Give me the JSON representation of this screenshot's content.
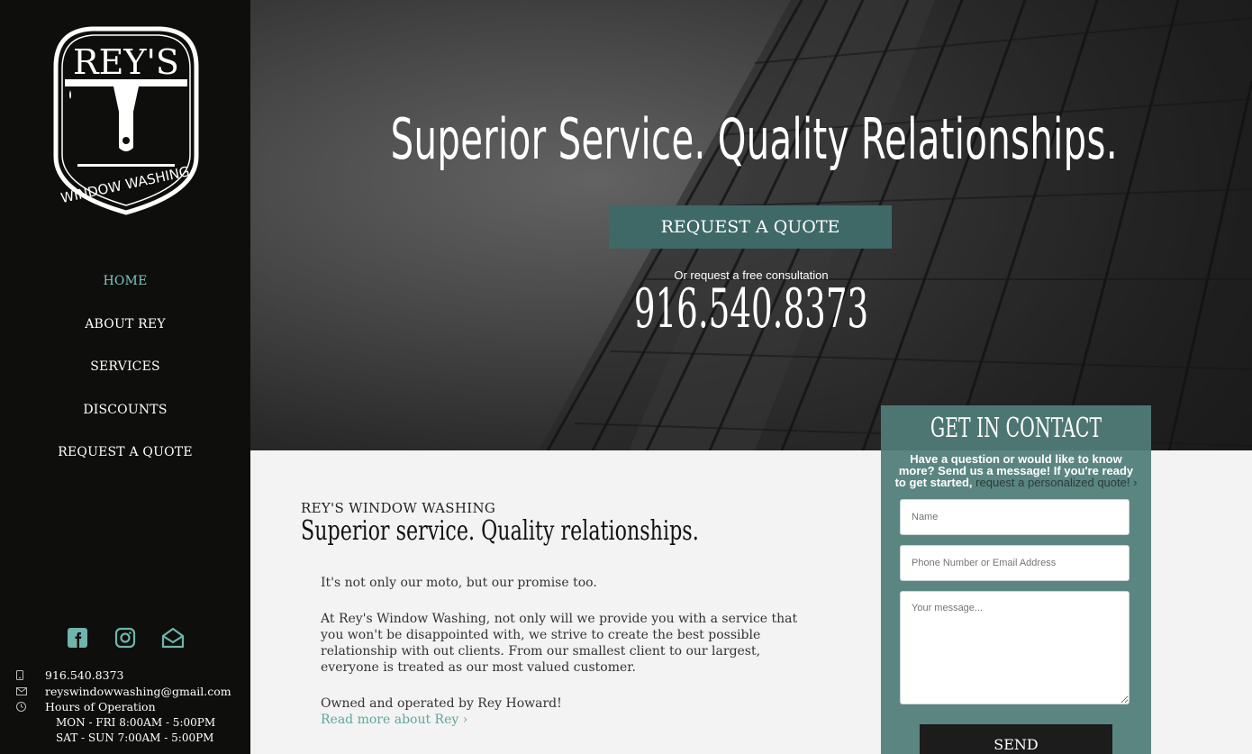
{
  "brand": {
    "logo_top": "REY'S",
    "logo_bottom": "WINDOW WASHING"
  },
  "nav": {
    "items": [
      {
        "label": "HOME",
        "active": true
      },
      {
        "label": "ABOUT REY",
        "active": false
      },
      {
        "label": "SERVICES",
        "active": false
      },
      {
        "label": "DISCOUNTS",
        "active": false
      },
      {
        "label": "REQUEST A QUOTE",
        "active": false
      }
    ]
  },
  "social": {
    "icons": [
      "facebook-icon",
      "instagram-icon",
      "email-icon"
    ]
  },
  "contact": {
    "phone": "916.540.8373",
    "email": "reyswindowwashing@gmail.com",
    "hours_label": "Hours of Operation",
    "hours_weekday": "MON - FRI 8:00AM - 5:00PM",
    "hours_weekend": "SAT - SUN 7:00AM - 5:00PM"
  },
  "hero": {
    "title": "Superior Service. Quality Relationships.",
    "cta": "REQUEST A QUOTE",
    "sub": "Or request a free consultation",
    "phone": "916.540.8373"
  },
  "main": {
    "company": "REY'S WINDOW WASHING",
    "tagline": "Superior service. Quality relationships.",
    "p1": "It's not only our moto, but our promise too.",
    "p2": "At Rey's Window Washing, not only will we provide you with a service that you won't be disappointed with, we strive to create the best possible relationship with out clients. From our smallest client to our largest, everyone is treated as our most valued customer.",
    "p3": "Owned and operated by Rey Howard!",
    "read_more": "Read more about Rey ›"
  },
  "form": {
    "title": "GET IN CONTACT",
    "desc": "Have a question or would like to know more? Send us a message! If you're ready to get started,",
    "desc_link": "request a personalized quote! ›",
    "name_placeholder": "Name",
    "contact_placeholder": "Phone Number or Email Address",
    "message_placeholder": "Your message...",
    "send": "SEND"
  },
  "colors": {
    "sidebar_bg": "#0e0e0c",
    "accent": "#7fc6bd",
    "button": "#3e6967",
    "form_bg": "#5b8580"
  }
}
